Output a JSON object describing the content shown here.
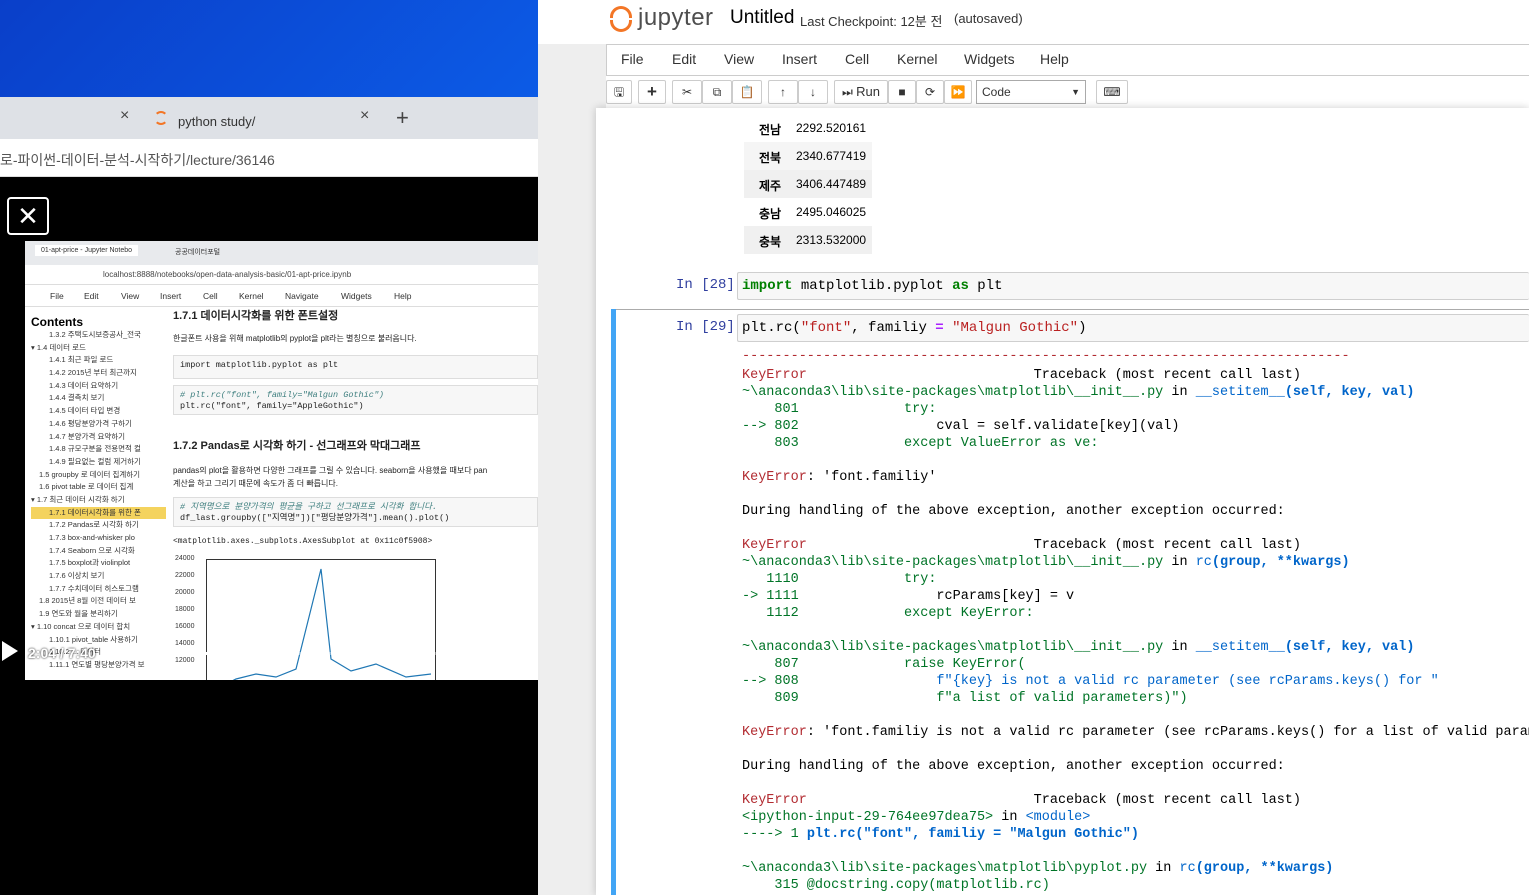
{
  "browser": {
    "tab2_title": "python study/",
    "url_text": "로-파이썬-데이터-분석-시작하기/lecture/36146",
    "close_glyph": "×",
    "new_tab_glyph": "+"
  },
  "video": {
    "time": "2:04 / 7:40",
    "progress": 0.27,
    "inner_tabs": [
      "01-apt-price - Jupyter Notebo",
      "공공데이터포털"
    ],
    "inner_url": "localhost:8888/notebooks/open-data-analysis-basic/01-apt-price.ipynb",
    "inner_menu": [
      "File",
      "Edit",
      "View",
      "Insert",
      "Cell",
      "Kernel",
      "Navigate",
      "Widgets",
      "Help"
    ],
    "toc_title": "Contents",
    "toc_items": [
      "1.3.2 주택도시보증공사_전국",
      "▾ 1.4 데이터 로드",
      "1.4.1 최근 파일 로드",
      "1.4.2 2015년 부터 최근까지",
      "1.4.3 데이터 요약하기",
      "1.4.4 결측치 보기",
      "1.4.5 데이터 타입 변경",
      "1.4.6 평당분양가격 구하기",
      "1.4.7 분양가격 요약하기",
      "1.4.8 규모구분을 전용면적 컬",
      "1.4.9 필요없는 컬럼 제거하기",
      "1.5 groupby 로 데이터 집계하기",
      "1.6 pivot table 로 데이터 집계",
      "▾ 1.7 최근 데이터 시각화 하기",
      "1.7.1 데이터시각화를 위한 폰",
      "1.7.2 Pandas로 시각화 하기",
      "1.7.3 box-and-whisker plo",
      "1.7.4 Seaborn 으로 시각화",
      "1.7.5 boxplot과 violinplot",
      "1.7.6 이상치 보기",
      "1.7.7 수치데이터 히스토그램",
      "1.8 2015년 8월 이전 데이터 보",
      "1.9 연도와 월을 분리하기",
      "▾ 1.10 concat 으로 데이터 합치",
      "1.10.1 pivot_table 사용하기",
      "1.10.2 ... 데이터",
      "1.11.1 연도별 평당분양가격 보"
    ],
    "heading1": "1.7.1  데이터시각화를 위한 폰트설정",
    "para1": "한글폰트 사용을 위해 matplotlib의 pyplot을 plt라는 별칭으로 불러옵니다.",
    "code1": "import matplotlib.pyplot as plt",
    "code2a": "# plt.rc(\"font\", family=\"Malgun Gothic\")",
    "code2b": "plt.rc(\"font\", family=\"AppleGothic\")",
    "heading2": "1.7.2  Pandas로 시각화 하기 - 선그래프와 막대그래프",
    "para2a": "pandas의 plot을 활용하면 다양한 그래프를 그릴 수 있습니다. seaborn을 사용했을 때보다 pan",
    "para2b": "계산을 하고 그리기 때문에 속도가 좀 더 빠릅니다.",
    "code3a": "# 지역명으로 분양가격의 평균을 구하고 선그래프로 시각화 합니다.",
    "code3b": "df_last.groupby([\"지역명\"])[\"평당분양가격\"].mean().plot()",
    "out3": "<matplotlib.axes._subplots.AxesSubplot at 0x11c0f5908>",
    "chart_ticks": [
      "24000",
      "22000",
      "20000",
      "18000",
      "16000",
      "14000",
      "12000"
    ]
  },
  "jupyter": {
    "brand": "jupyter",
    "title": "Untitled",
    "checkpoint": "Last Checkpoint: 12분 전",
    "autosaved": "(autosaved)",
    "menu": [
      "File",
      "Edit",
      "View",
      "Insert",
      "Cell",
      "Kernel",
      "Widgets",
      "Help"
    ],
    "run_label": "Run",
    "cell_type": "Code",
    "df_rows": [
      {
        "k": "전남",
        "v": "2292.520161"
      },
      {
        "k": "전북",
        "v": "2340.677419"
      },
      {
        "k": "제주",
        "v": "3406.447489"
      },
      {
        "k": "충남",
        "v": "2495.046025"
      },
      {
        "k": "충북",
        "v": "2313.532000"
      }
    ],
    "prompt28": "In [28]:",
    "prompt29": "In [29]:",
    "cell28": {
      "kw1": "import",
      "mid": " matplotlib.pyplot ",
      "kw2": "as",
      "end": " plt"
    },
    "cell29": {
      "a": "plt.rc(",
      "s1": "\"font\"",
      "b": ", familiy ",
      "op": "=",
      "c": " ",
      "s2": "\"Malgun Gothic\"",
      "d": ")"
    },
    "traceback": {
      "sep": "---------------------------------------------------------------------------",
      "err1_name": "KeyError",
      "tb_hdr": "                            Traceback (most recent call last)",
      "f1_path": "~\\anaconda3\\lib\\site-packages\\matplotlib\\__init__.py",
      "in": " in ",
      "f1_func": "__setitem__",
      "f1_args": "(self, key, val)",
      "f1_l801": "    801             try:",
      "f1_l802a": "--> 802 ",
      "f1_l802b": "                cval = self.validate[key](val)",
      "f1_l803": "    803             except ValueError as ve:",
      "msg1": ": 'font.familiy'",
      "during1": "During handling of the above exception, another exception occurred:",
      "f2_func": "rc",
      "f2_args": "(group, **kwargs)",
      "f2_l1110": "   1110             try:",
      "f2_l1111a": "-> 1111 ",
      "f2_l1111b": "                rcParams[key] = v",
      "f2_l1112": "   1112             except KeyError:",
      "f3_l807": "    807             raise KeyError(",
      "f3_l808a": "--> 808 ",
      "f3_l808b": "                f\"{key} is not a valid rc parameter (see rcParams.keys() for \"",
      "f3_l809": "    809                 f\"a list of valid parameters)\")",
      "msg2": ": 'font.familiy is not a valid rc parameter (see rcParams.keys() for a list of valid parameters)'",
      "during2": "During handling of the above exception, another exception occurred:",
      "ipy_input": "<ipython-input-29-764ee97dea75>",
      "module": "<module>",
      "l1a": "----> 1 ",
      "l1b": "plt.rc(\"font\", familiy = \"Malgun Gothic\")",
      "f4_path": "~\\anaconda3\\lib\\site-packages\\matplotlib\\pyplot.py",
      "f4_l315": "    315 @docstring.copy(matplotlib.rc)"
    }
  }
}
